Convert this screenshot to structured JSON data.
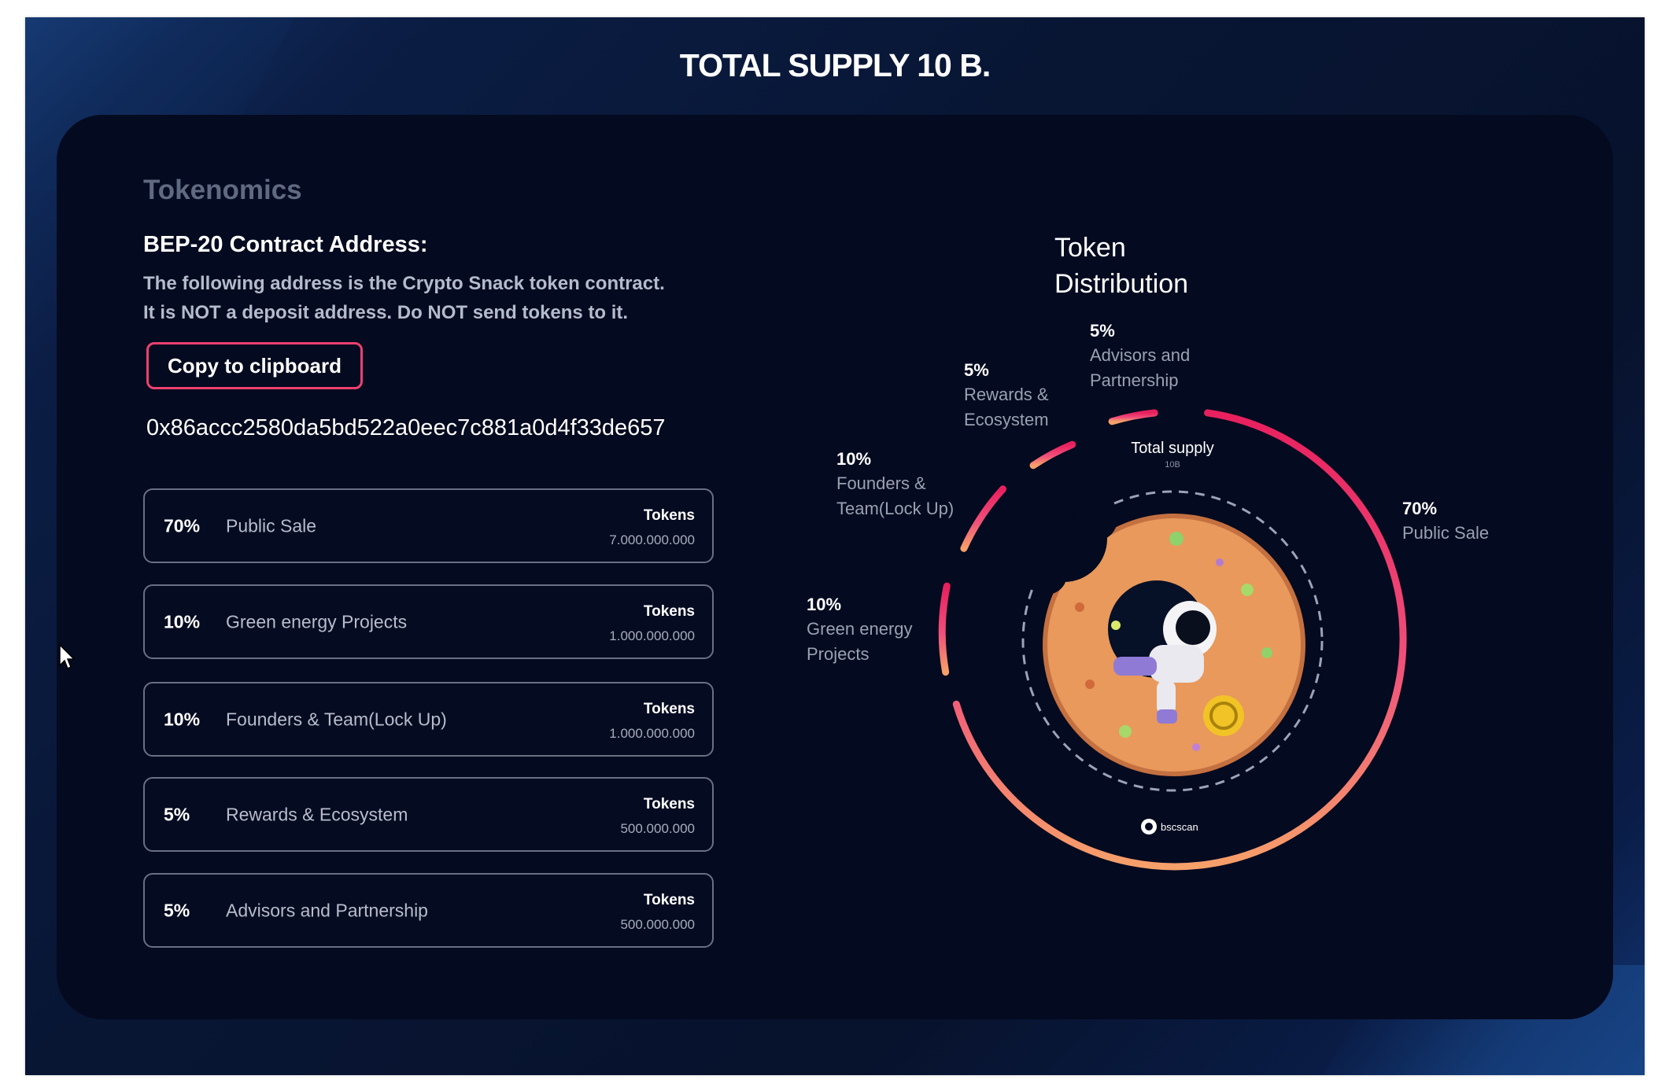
{
  "page_title": "TOTAL SUPPLY 10 B.",
  "section_title": "Tokenomics",
  "contract": {
    "heading": "BEP-20 Contract Address:",
    "description_line1": "The following address is the Crypto Snack token contract.",
    "description_line2": "It is NOT a deposit address. Do NOT send tokens to it.",
    "copy_button_label": "Copy to clipboard",
    "address": "0x86accc2580da5bd522a0eec7c881a0d4f33de657"
  },
  "allocations": [
    {
      "pct": "70%",
      "name": "Public Sale",
      "tokens_label": "Tokens",
      "amount": "7.000.000.000"
    },
    {
      "pct": "10%",
      "name": "Green energy Projects",
      "tokens_label": "Tokens",
      "amount": "1.000.000.000"
    },
    {
      "pct": "10%",
      "name": "Founders & Team(Lock Up)",
      "tokens_label": "Tokens",
      "amount": "1.000.000.000"
    },
    {
      "pct": "5%",
      "name": "Rewards & Ecosystem",
      "tokens_label": "Tokens",
      "amount": "500.000.000"
    },
    {
      "pct": "5%",
      "name": "Advisors and Partnership",
      "tokens_label": "Tokens",
      "amount": "500.000.000"
    }
  ],
  "distribution": {
    "title_line1": "Token",
    "title_line2": "Distribution",
    "center_label": "Total supply",
    "center_sub": "10B",
    "badge_text": "bscscan",
    "labels": [
      {
        "pct": "5%",
        "line1": "Advisors and",
        "line2": "Partnership"
      },
      {
        "pct": "5%",
        "line1": "Rewards &",
        "line2": "Ecosystem"
      },
      {
        "pct": "10%",
        "line1": "Founders &",
        "line2": "Team(Lock Up)"
      },
      {
        "pct": "10%",
        "line1": "Green energy",
        "line2": "Projects"
      },
      {
        "pct": "70%",
        "line1": "Public Sale",
        "line2": ""
      }
    ]
  },
  "colors": {
    "accent_pink": "#f0406f",
    "ring_start": "#e8205e",
    "ring_end": "#f6a06a",
    "background": "#07122c",
    "card": "#040a1f"
  },
  "icons": {
    "cursor": "mouse-pointer-icon",
    "badge": "bscscan-logo-icon",
    "illustration": "donut-astronaut-illustration"
  }
}
